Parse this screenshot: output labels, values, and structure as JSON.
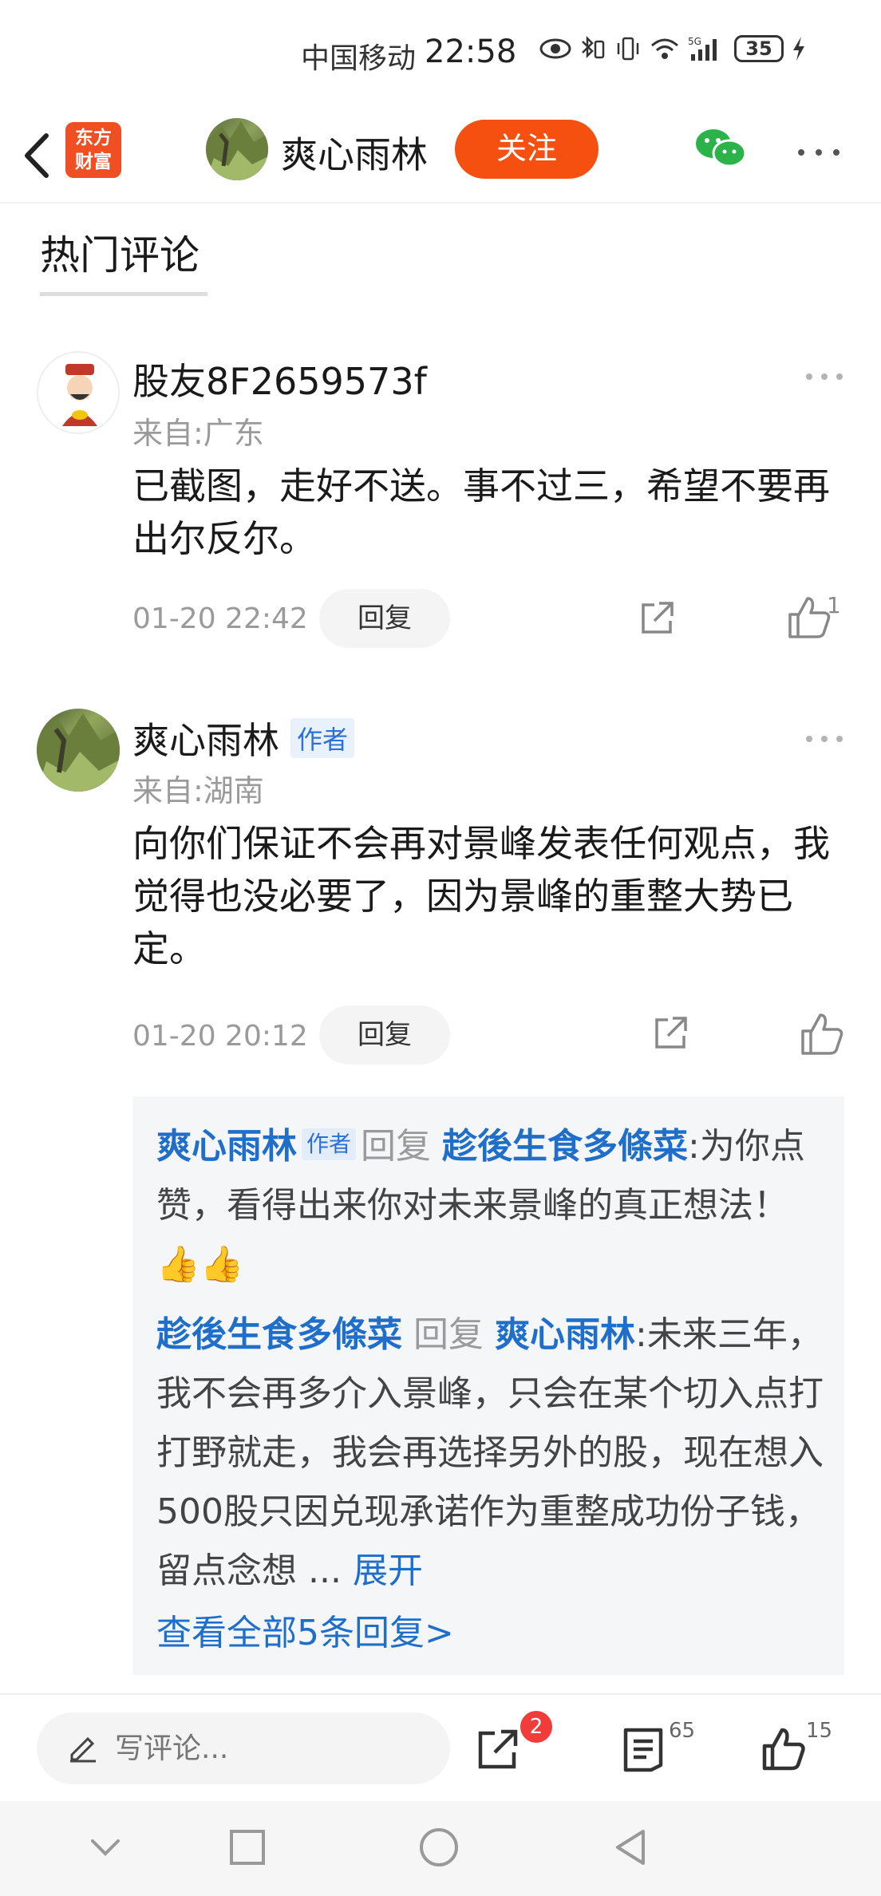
{
  "status_bar": {
    "carrier": "中国移动",
    "time": "22:58",
    "battery": "35"
  },
  "nav": {
    "logo_line1": "东方",
    "logo_line2": "财富",
    "author_name": "爽心雨林",
    "follow_label": "关注"
  },
  "section_title": "热门评论",
  "comments": [
    {
      "author": "股友8F2659573f",
      "location": "来自:广东",
      "text": "已截图，走好不送。事不过三，希望不要再出尔反尔。",
      "time": "01-20 22:42",
      "reply_label": "回复",
      "like_count": "1"
    },
    {
      "author": "爽心雨林",
      "badge": "作者",
      "location": "来自:湖南",
      "text": "向你们保证不会再对景峰发表任何观点，我觉得也没必要了，因为景峰的重整大势已定。",
      "time": "01-20 20:12",
      "reply_label": "回复"
    }
  ],
  "replies": [
    {
      "from": "爽心雨林",
      "badge": "作者",
      "verb": "回复",
      "to": "趁後生食多條菜",
      "text": ":为你点赞，看得出来你对未来景峰的真正想法！👍👍"
    },
    {
      "from": "趁後生食多條菜",
      "verb": "回复",
      "to": "爽心雨林",
      "text": ":未来三年，我不会再多介入景峰，只会在某个切入点打打野就走，我会再选择另外的股，现在想入500股只因兑现承诺作为重整成功份子钱，留点念想 ...",
      "expand": "展开"
    }
  ],
  "view_all_replies": "查看全部5条回复>",
  "bottom_bar": {
    "input_placeholder": "写评论...",
    "share_badge": "2",
    "comment_count": "65",
    "like_count": "15"
  },
  "colors": {
    "accent_orange": "#f5500f",
    "link_blue": "#1f6fca",
    "badge_red": "#f23b3b"
  }
}
